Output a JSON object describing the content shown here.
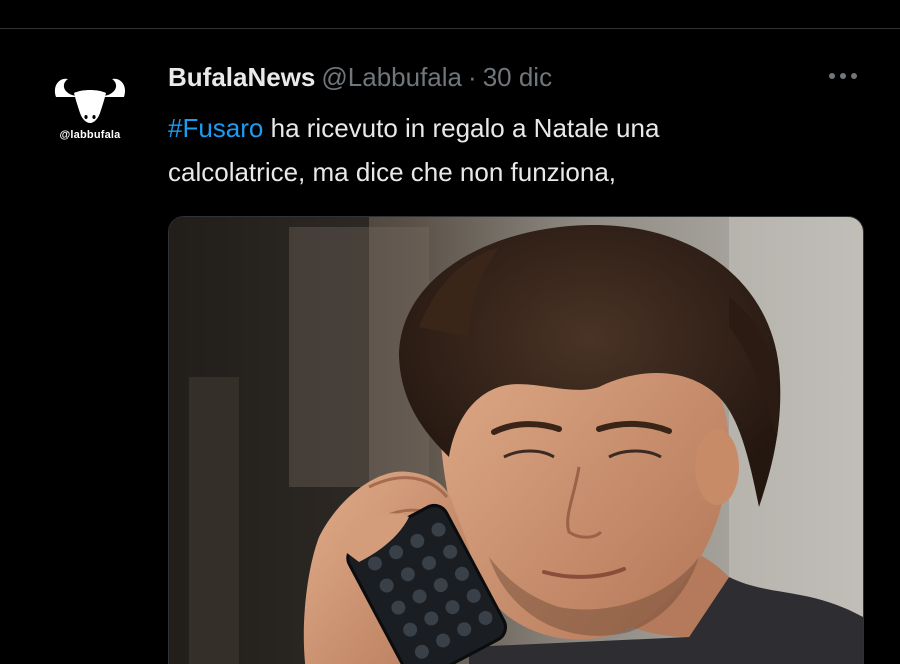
{
  "tweet": {
    "avatar": {
      "caption": "@labbufala",
      "icon": "buffalo-logo-icon"
    },
    "display_name": "BufalaNews",
    "handle": "@Labbufala",
    "separator": "·",
    "date": "30 dic",
    "more_icon": "more-horizontal-icon",
    "text": {
      "hashtag": "#Fusaro",
      "line1_rest": " ha ricevuto in regalo a Natale una",
      "line2": "calcolatrice, ma dice che non funziona,"
    },
    "media": {
      "description_icon": "photo-icon"
    }
  },
  "colors": {
    "background": "#000000",
    "primary_text": "#e7e9ea",
    "secondary_text": "#71767b",
    "link": "#1d9bf0",
    "border": "#2f3336"
  }
}
